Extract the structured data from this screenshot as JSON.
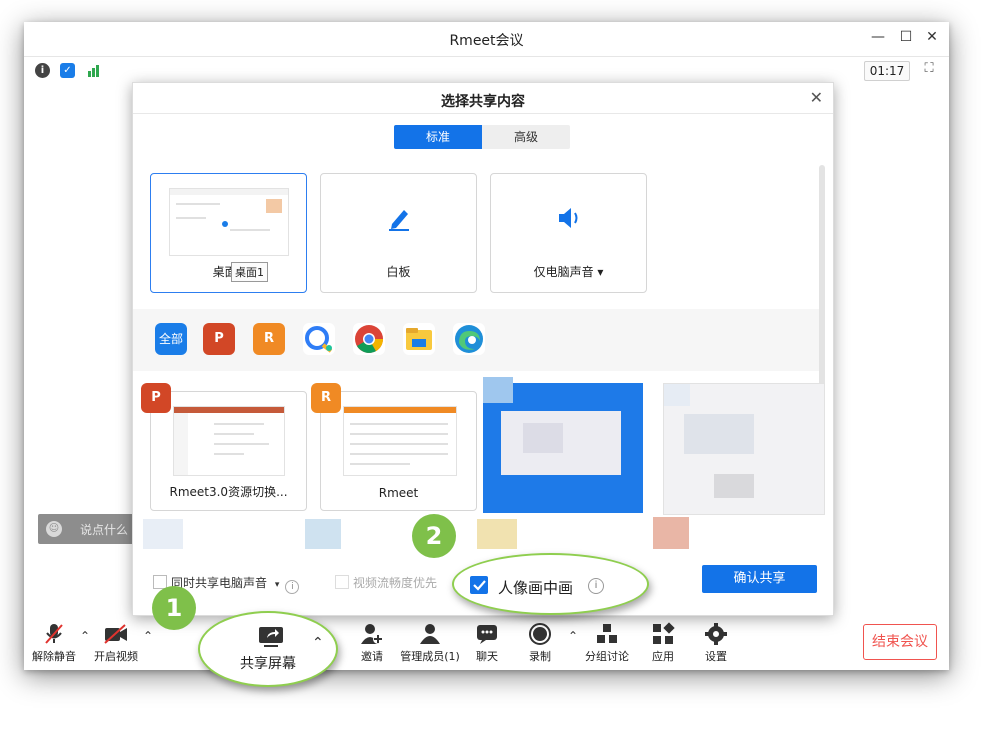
{
  "window": {
    "title": "Rmeet会议",
    "controls": {
      "minimize": "—",
      "maximize": "☐",
      "close": "✕"
    },
    "timer": "01:17",
    "status_icons": [
      "info-icon",
      "shield-icon",
      "signal-icon"
    ]
  },
  "chat": {
    "placeholder": "说点什么"
  },
  "dialog": {
    "title": "选择共享内容",
    "tabs": [
      {
        "label": "标准",
        "active": true
      },
      {
        "label": "高级",
        "active": false
      }
    ],
    "main_cards": [
      {
        "label": "桌面1",
        "tooltip": "桌面1",
        "selected": true
      },
      {
        "label": "白板"
      },
      {
        "label": "仅电脑声音 ▾"
      }
    ],
    "app_filters": [
      {
        "label": "全部",
        "icon": "all-icon"
      },
      {
        "icon": "powerpoint-icon"
      },
      {
        "icon": "rmeet-app-icon"
      },
      {
        "icon": "feishu-icon"
      },
      {
        "icon": "chrome-icon"
      },
      {
        "icon": "file-explorer-icon"
      },
      {
        "icon": "edge-icon"
      }
    ],
    "windows": [
      {
        "label": "Rmeet3.0资源切换...",
        "icon": "powerpoint-icon"
      },
      {
        "label": "Rmeet",
        "icon": "rmeet-app-icon"
      }
    ],
    "options": {
      "share_audio": "同时共享电脑声音",
      "video_smooth": "视频流畅度优先",
      "pip": "人像画中画",
      "pip_checked": true
    },
    "confirm_label": "确认共享"
  },
  "toolbar": {
    "items": [
      {
        "label": "解除静音",
        "icon": "microphone-muted-icon"
      },
      {
        "label": "开启视频",
        "icon": "camera-off-icon"
      },
      {
        "label": "共享屏幕",
        "icon": "share-screen-icon"
      },
      {
        "label": "邀请",
        "icon": "invite-icon"
      },
      {
        "label": "管理成员(1)",
        "icon": "members-icon"
      },
      {
        "label": "聊天",
        "icon": "chat-icon"
      },
      {
        "label": "录制",
        "icon": "record-icon"
      },
      {
        "label": "分组讨论",
        "icon": "breakout-icon"
      },
      {
        "label": "应用",
        "icon": "apps-icon"
      },
      {
        "label": "设置",
        "icon": "settings-icon"
      }
    ],
    "end_label": "结束会议"
  },
  "annotations": {
    "step1": "1",
    "step2": "2"
  },
  "colors": {
    "accent": "#1373e8",
    "danger": "#f0544f",
    "callout": "#7fc04a"
  }
}
